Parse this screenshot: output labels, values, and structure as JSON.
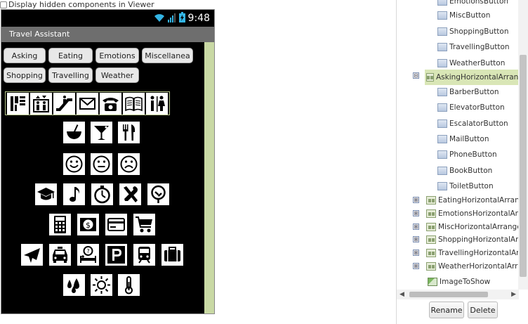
{
  "viewer": {
    "hidden_checkbox_label": "Display hidden components in Viewer"
  },
  "status": {
    "time": "9:48"
  },
  "app": {
    "title": "Travel Assistant"
  },
  "buttons_row1": [
    "Asking",
    "Eating",
    "Emotions",
    "Miscellanea"
  ],
  "buttons_row2": [
    "Shopping",
    "Travelling",
    "Weather"
  ],
  "icon_rows": {
    "asking": [
      "barber-icon",
      "elevator-icon",
      "escalator-icon",
      "mail-icon",
      "phone-icon",
      "book-icon",
      "toilet-icon"
    ],
    "eating": [
      "bowl-icon",
      "cocktail-icon",
      "cutlery-icon"
    ],
    "emotions": [
      "happy-face-icon",
      "neutral-face-icon",
      "sad-face-icon"
    ],
    "misc": [
      "graduation-cap-icon",
      "music-note-icon",
      "stopwatch-icon",
      "tools-icon",
      "tree-icon"
    ],
    "shopping": [
      "calculator-icon",
      "money-icon",
      "credit-card-icon",
      "cart-icon"
    ],
    "travelling": [
      "airplane-icon",
      "taxi-icon",
      "hotel-icon",
      "parking-icon",
      "train-icon",
      "suitcase-icon"
    ],
    "weather": [
      "rain-drops-icon",
      "sun-icon",
      "thermometer-icon"
    ]
  },
  "tree": {
    "items": [
      {
        "label": "EmotionsButton"
      },
      {
        "label": "MiscButton"
      },
      {
        "label": "ShoppingButton"
      },
      {
        "label": "TravellingButton"
      },
      {
        "label": "WeatherButton"
      },
      {
        "label": "AskingHorizontalArrange"
      },
      {
        "label": "BarberButton"
      },
      {
        "label": "ElevatorButton"
      },
      {
        "label": "EscalatorButton"
      },
      {
        "label": "MailButton"
      },
      {
        "label": "PhoneButton"
      },
      {
        "label": "BookButton"
      },
      {
        "label": "ToiletButton"
      },
      {
        "label": "EatingHorizontalArrange"
      },
      {
        "label": "EmotionsHorizontalArrange"
      },
      {
        "label": "MiscHorizontalArrangement"
      },
      {
        "label": "ShoppingHorizontalArrange"
      },
      {
        "label": "TravellingHorizontalArrange"
      },
      {
        "label": "WeatherHorizontalArrange"
      },
      {
        "label": "ImageToShow"
      }
    ],
    "expand_glyph": "⊞",
    "collapse_glyph": "⊟"
  },
  "actions": {
    "rename": "Rename",
    "delete": "Delete"
  },
  "colors": {
    "selected_bg": "#d9e6b6",
    "right_bar": "#c9d9a4",
    "titlebar": "#6e6e6e"
  }
}
